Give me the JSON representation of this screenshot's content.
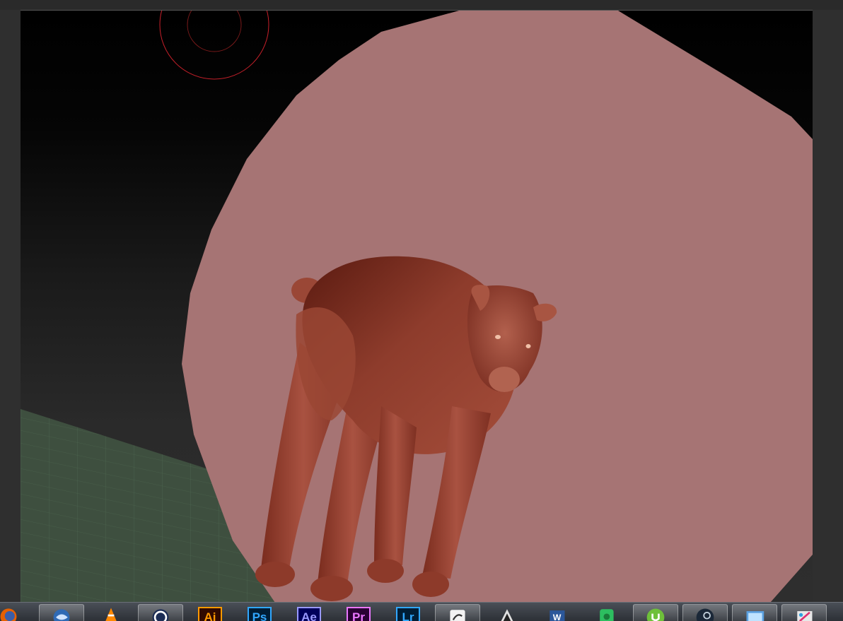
{
  "app": {
    "name": "3D sculpting viewport",
    "colors": {
      "background_top": "#000000",
      "background_bottom": "#2e2e2e",
      "backdrop_disc": "#a67474",
      "model": "#8c3a2a",
      "floor_grid": "#3f5240",
      "brush_cursor": "#c8202a"
    }
  },
  "viewport": {
    "model_subject": "bear",
    "brush_cursor_icon": "brush-radius-cursor"
  },
  "taskbar": {
    "items": [
      {
        "name": "firefox",
        "icon": "firefox-icon",
        "label": "",
        "active": false
      },
      {
        "name": "thunderbird",
        "icon": "thunderbird-icon",
        "label": "",
        "active": true
      },
      {
        "name": "vlc",
        "icon": "vlc-icon",
        "label": "",
        "active": false
      },
      {
        "name": "cinema4d",
        "icon": "cinema4d-icon",
        "label": "",
        "active": true
      },
      {
        "name": "illustrator",
        "icon": "illustrator-icon",
        "label": "Ai",
        "active": false,
        "color": "#ff9a00",
        "bg": "#300a00"
      },
      {
        "name": "photoshop",
        "icon": "photoshop-icon",
        "label": "Ps",
        "active": false,
        "color": "#31a8ff",
        "bg": "#001e36"
      },
      {
        "name": "after-effects",
        "icon": "after-effects-icon",
        "label": "Ae",
        "active": false,
        "color": "#9999ff",
        "bg": "#00005b"
      },
      {
        "name": "premiere",
        "icon": "premiere-icon",
        "label": "Pr",
        "active": false,
        "color": "#ea77ff",
        "bg": "#2a0134"
      },
      {
        "name": "lightroom",
        "icon": "lightroom-icon",
        "label": "Lr",
        "active": false,
        "color": "#31a8ff",
        "bg": "#001e36"
      },
      {
        "name": "zbrush",
        "icon": "zbrush-icon",
        "label": "",
        "active": true
      },
      {
        "name": "unity",
        "icon": "unity-icon",
        "label": "",
        "active": false
      },
      {
        "name": "word",
        "icon": "word-icon",
        "label": "W",
        "active": false
      },
      {
        "name": "evernote",
        "icon": "evernote-icon",
        "label": "",
        "active": false
      },
      {
        "name": "utorrent",
        "icon": "utorrent-icon",
        "label": "",
        "active": true
      },
      {
        "name": "steam",
        "icon": "steam-icon",
        "label": "",
        "active": true
      },
      {
        "name": "photos",
        "icon": "photos-icon",
        "label": "",
        "active": true
      },
      {
        "name": "paint",
        "icon": "paint-icon",
        "label": "",
        "active": true
      }
    ]
  }
}
